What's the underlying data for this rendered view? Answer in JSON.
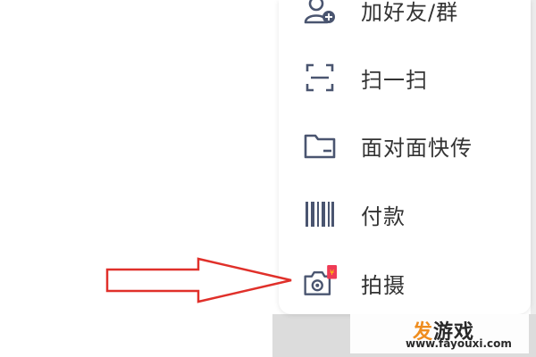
{
  "menu": {
    "items": [
      {
        "label": "加好友/群",
        "icon": "add-contact-icon"
      },
      {
        "label": "扫一扫",
        "icon": "scan-icon"
      },
      {
        "label": "面对面快传",
        "icon": "folder-transfer-icon"
      },
      {
        "label": "付款",
        "icon": "barcode-icon"
      },
      {
        "label": "拍摄",
        "icon": "camera-icon",
        "badge": "¥"
      }
    ]
  },
  "annotation": {
    "icon": "red-arrow-icon",
    "color": "#e0302a"
  },
  "watermark": {
    "title_accent": "发",
    "title_rest": "游戏",
    "url": "www.fayouxi.com"
  },
  "colors": {
    "accent_blue": "#4a5570",
    "badge_red": "#ef3b55",
    "arrow_red": "#e0302a"
  }
}
